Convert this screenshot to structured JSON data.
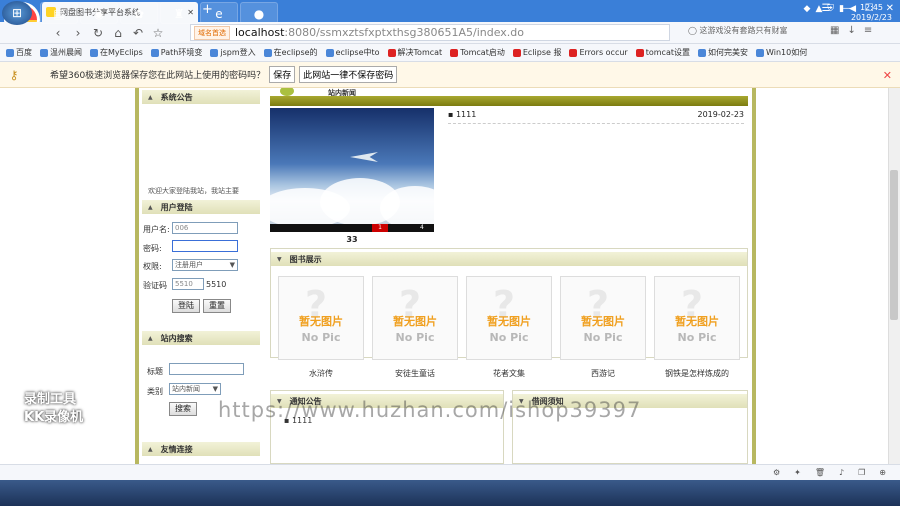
{
  "browser": {
    "tab_title": "网盘图书分享平台系统",
    "new_tab": "+",
    "address_tag": "域名首选",
    "url_host": "localhost",
    "url_path": ":8080/ssmxztsfxptxthsg380651A5/index.do",
    "search_placeholder": "这游戏没有套路只有财富",
    "bookmarks": [
      "百度",
      "温州晨闻",
      "在MyEclips",
      "Path环境变",
      "jspm登入",
      "在eclipse的",
      "eclipse中to",
      "解决Tomcat",
      "Tomcat启动",
      "Eclipse 报",
      "Errors occur",
      "tomcat设置",
      "如何完美安",
      "Win10如何"
    ],
    "password_prompt": "希望360极速浏览器保存您在此网站上使用的密码吗？",
    "save_btn": "保存",
    "never_btn": "此网站一律不保存密码"
  },
  "left": {
    "notice_title": "系统公告",
    "notice_text": "欢迎大家登陆我站，我站主要",
    "login_title": "用户登陆",
    "username_label": "用户名:",
    "username_value": "006",
    "password_label": "密码:",
    "role_label": "权限:",
    "role_value": "注册用户",
    "captcha_label": "验证码",
    "captcha_value": "5510",
    "captcha_code": "5510",
    "login_btn": "登陆",
    "reset_btn": "重置",
    "search_title": "站内搜索",
    "keyword_label": "标题",
    "category_label": "类别",
    "category_value": "站内新闻",
    "search_btn": "搜索",
    "links_title": "友情连接"
  },
  "news": {
    "title": "站内新闻",
    "image_caption": "33",
    "slide_active": "1",
    "slide_last": "4",
    "item_title": "1111",
    "item_date": "2019-02-23"
  },
  "books": {
    "title": "图书展示",
    "no_image": "暂无图片",
    "no_pic": "No Pic",
    "items": [
      "水浒传",
      "安徒生童话",
      "花者文集",
      "西游记",
      "钢铁是怎样炼成的"
    ]
  },
  "notices": {
    "title": "通知公告",
    "item": "1111",
    "title2": "借阅须知"
  },
  "watermark": "https://www.huzhan.com/ishop39397",
  "recorder": "录制工具\nKK录像机",
  "clock": {
    "time": "12:45",
    "date": "2019/2/23"
  }
}
